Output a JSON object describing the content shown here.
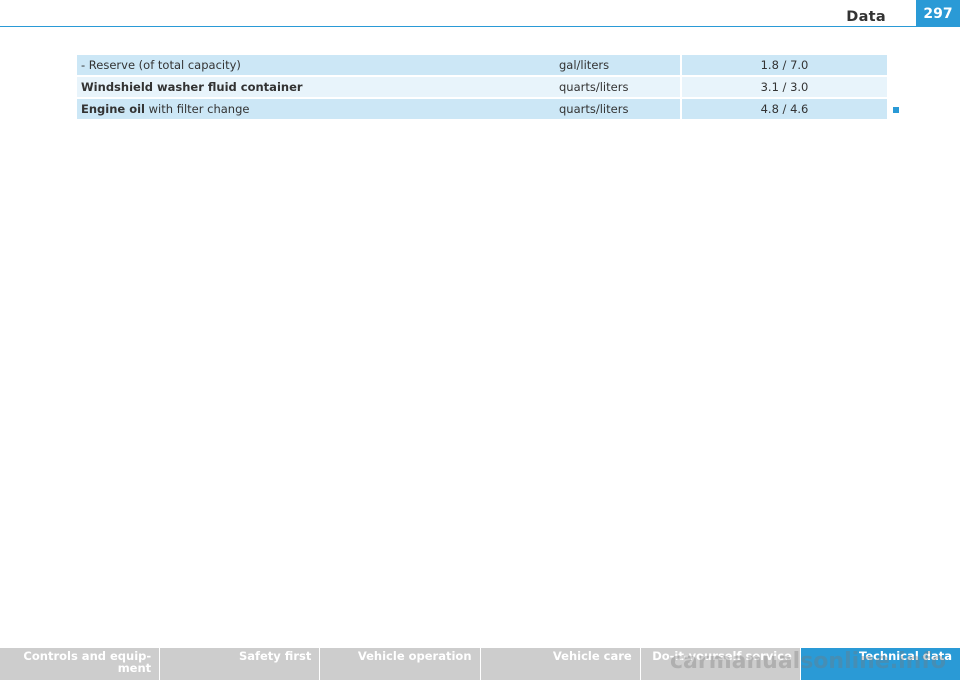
{
  "header": {
    "title": "Data",
    "page_number": "297"
  },
  "table": {
    "rows": [
      {
        "desc_bold": "",
        "desc_rest": "- Reserve (of total capacity)",
        "unit": "gal/liters",
        "value": "1.8 / 7.0"
      },
      {
        "desc_bold": "Windshield washer fluid container",
        "desc_rest": "",
        "unit": "quarts/liters",
        "value": "3.1 / 3.0"
      },
      {
        "desc_bold": "Engine oil",
        "desc_rest": " with filter change",
        "unit": "quarts/liters",
        "value": "4.8 / 4.6"
      }
    ]
  },
  "footer": {
    "tabs": [
      {
        "label": "Controls and equip-\nment"
      },
      {
        "label": "Safety first"
      },
      {
        "label": "Vehicle operation"
      },
      {
        "label": "Vehicle care"
      },
      {
        "label": "Do-it-yourself service"
      },
      {
        "label": "Technical data"
      }
    ],
    "active_index": 5
  },
  "watermark": "carmanualsonline.info",
  "colors": {
    "accent": "#2a9ad6",
    "row_dark": "#cce7f6",
    "row_light": "#e8f4fb",
    "footer_bg": "#cdcdcd"
  }
}
